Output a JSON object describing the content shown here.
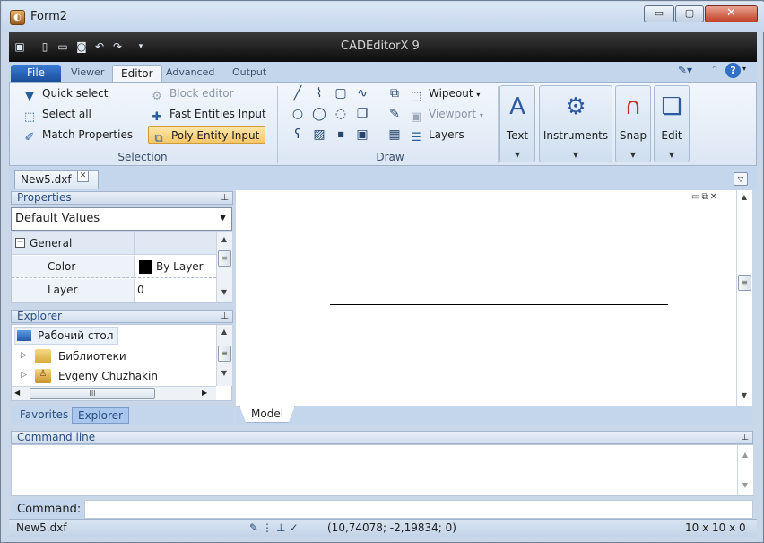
{
  "window": {
    "title": "Form2",
    "app_title": "CADEditorX 9",
    "min_label": "▭",
    "max_label": "▢",
    "close_label": "✕"
  },
  "qat": {
    "icons": [
      "window-icon",
      "new-file-icon",
      "open-folder-icon",
      "save-icon",
      "undo-icon",
      "redo-icon",
      "customize-icon"
    ]
  },
  "tabs": [
    {
      "label": "File"
    },
    {
      "label": "Viewer"
    },
    {
      "label": "Editor"
    },
    {
      "label": "Advanced"
    },
    {
      "label": "Output"
    }
  ],
  "ribbon": {
    "selection": {
      "label": "Selection",
      "quick_select": "Quick select",
      "select_all": "Select all",
      "match_properties": "Match Properties",
      "block_editor": "Block editor",
      "fast_entities": "Fast Entities Input",
      "poly_entity": "Poly Entity Input"
    },
    "draw": {
      "label": "Draw",
      "wipeout": "Wipeout",
      "viewport": "Viewport",
      "layers": "Layers"
    },
    "big": {
      "text": "Text",
      "instruments": "Instruments",
      "snap": "Snap",
      "edit": "Edit"
    }
  },
  "document": {
    "tab": "New5.dxf"
  },
  "properties": {
    "header": "Properties",
    "combo": "Default Values",
    "group": "General",
    "rows": [
      {
        "name": "Color",
        "value": "By Layer"
      },
      {
        "name": "Layer",
        "value": "0"
      }
    ]
  },
  "explorer": {
    "header": "Explorer",
    "items": [
      "Рабочий стол",
      "Библиотеки",
      "Evgeny Chuzhakin"
    ],
    "hscroll_thumb": "III"
  },
  "bottom_tabs": [
    "Favorites",
    "Explorer"
  ],
  "model_tab": "Model",
  "command": {
    "header": "Command line",
    "label": "Command:",
    "value": ""
  },
  "status": {
    "file": "New5.dxf",
    "coords": "(10,74078; -2,19834; 0)",
    "scale": "10 x 10 x 0"
  }
}
